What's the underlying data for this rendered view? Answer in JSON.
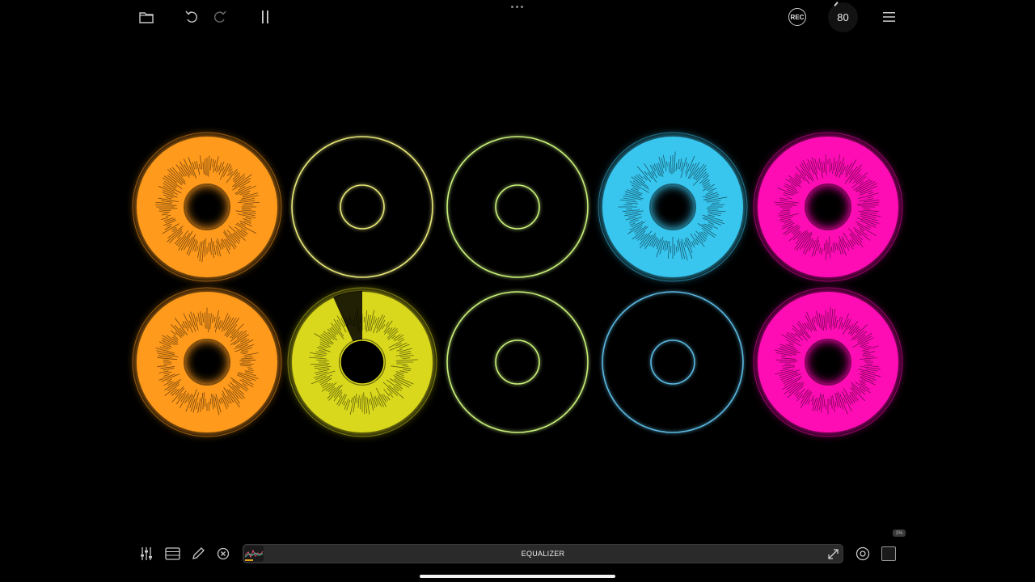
{
  "toolbar": {
    "folder_icon": "folder-icon",
    "undo_icon": "undo-icon",
    "redo_icon": "redo-icon",
    "pause_icon": "pause-icon",
    "rec_label": "REC",
    "bpm_value": "80",
    "menu_icon": "hamburger-menu-icon"
  },
  "pads": [
    {
      "row": 1,
      "col": 1,
      "color": "#ff9a1a",
      "state": "playing"
    },
    {
      "row": 1,
      "col": 2,
      "color": "#e8e87a",
      "state": "empty"
    },
    {
      "row": 1,
      "col": 3,
      "color": "#c8f07a",
      "state": "empty"
    },
    {
      "row": 1,
      "col": 4,
      "color": "#39c6ef",
      "state": "playing"
    },
    {
      "row": 1,
      "col": 5,
      "color": "#ff10b4",
      "state": "playing"
    },
    {
      "row": 2,
      "col": 1,
      "color": "#ff9a1a",
      "state": "playing"
    },
    {
      "row": 2,
      "col": 2,
      "color": "#d9d81a",
      "state": "playing",
      "progress": 0.93
    },
    {
      "row": 2,
      "col": 3,
      "color": "#c8f07a",
      "state": "empty"
    },
    {
      "row": 2,
      "col": 4,
      "color": "#5ab8e0",
      "state": "empty"
    },
    {
      "row": 2,
      "col": 5,
      "color": "#ff10b4",
      "state": "playing"
    }
  ],
  "bottom": {
    "mixer_icon": "mixer-sliders-icon",
    "sequencer_icon": "list-icon",
    "edit_icon": "pencil-icon",
    "clear_icon": "close-circle-icon",
    "panel_label": "EQUALIZER",
    "expand_icon": "expand-icon",
    "target_icon": "target-icon",
    "cpu_label": "1%"
  }
}
